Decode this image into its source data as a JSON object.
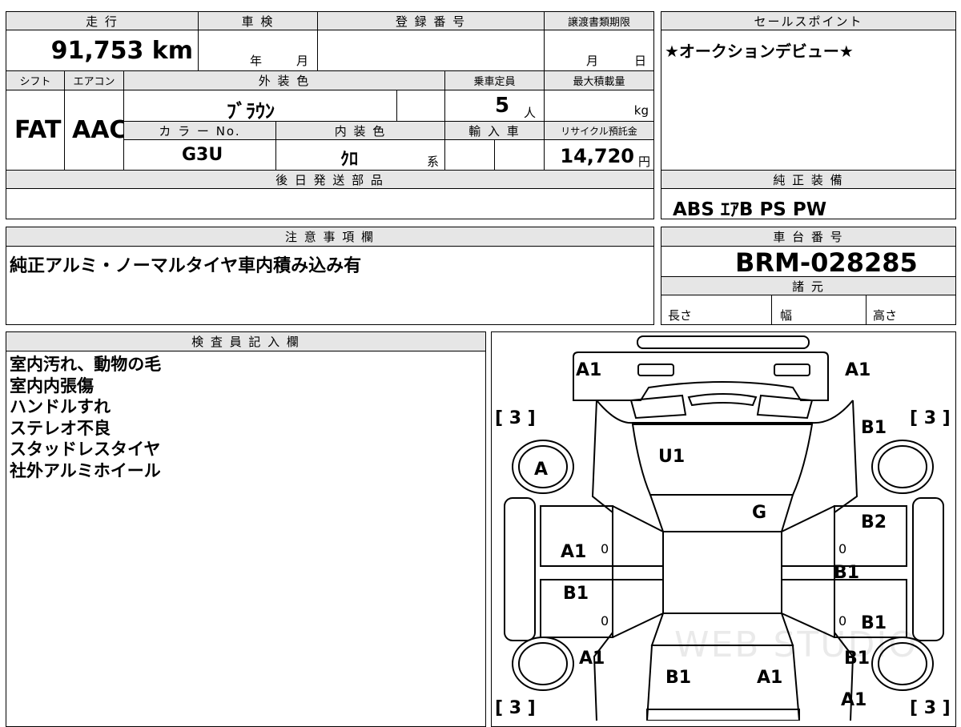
{
  "top_left": {
    "mileage_label": "走 行",
    "mileage_value": "91,753 km",
    "inspection_label": "車 検",
    "inspection_year_unit": "年",
    "inspection_month_unit": "月",
    "registration_label": "登 録 番 号",
    "transfer_label": "譲渡書類期限",
    "transfer_month_unit": "月",
    "transfer_day_unit": "日",
    "shift_label": "シフト",
    "shift_value": "FAT",
    "ac_label": "エアコン",
    "ac_value": "AAC",
    "exterior_color_label": "外 装 色",
    "exterior_color_value": "ﾌﾞﾗｳﾝ",
    "capacity_label": "乗車定員",
    "capacity_value": "5",
    "capacity_unit": "人",
    "max_load_label": "最大積載量",
    "max_load_unit": "kg",
    "color_no_label": "カ ラ ー No.",
    "color_no_value": "G3U",
    "interior_color_label": "内 装 色",
    "interior_color_value": "ｸﾛ",
    "interior_color_suffix": "系",
    "import_label": "輸 入 車",
    "recycle_label": "リサイクル預託金",
    "recycle_value": "14,720",
    "recycle_unit": "円",
    "later_parts_label": "後 日 発 送 部 品"
  },
  "selling_points": {
    "label": "セールスポイント",
    "text": "★オークションデビュー★"
  },
  "genuine_equipment": {
    "label": "純 正 装 備",
    "value": "ABS ｴｱB PS PW"
  },
  "notes": {
    "label": "注 意 事 項 欄",
    "text": "純正アルミ・ノーマルタイヤ車内積み込み有"
  },
  "chassis": {
    "label": "車 台 番 号",
    "value": "BRM-028285"
  },
  "specs": {
    "label": "諸 元",
    "length_label": "長さ",
    "width_label": "幅",
    "height_label": "高さ"
  },
  "inspector": {
    "label": "検 査 員 記 入 欄",
    "lines": [
      "室内汚れ、動物の毛",
      "室内内張傷",
      "ハンドルすれ",
      "ステレオ不良",
      "スタッドレスタイヤ",
      "社外アルミホイール"
    ]
  },
  "car_map": {
    "watermark": "WEB STUDIO",
    "marks": {
      "hood_left": "A1",
      "hood_right": "A1",
      "tire_fl": "[ 3 ]",
      "tire_fr": "[ 3 ]",
      "tire_rl": "[ 3 ]",
      "tire_rr": "[ 3 ]",
      "front_wheel_left": "A",
      "fender_right": "B1",
      "windshield": "U1",
      "roof": "G",
      "front_door_left": "A1",
      "front_door_left_zero": "0",
      "rear_door_left": "B1",
      "rear_door_left_zero": "0",
      "front_door_right": "B2",
      "front_door_right_zero": "0",
      "rocker_right": "B1",
      "rear_door_right": "B1",
      "rear_door_right_zero": "0",
      "rear_fender_left": "A1",
      "rear_fender_right": "B1",
      "rear_left": "B1",
      "rear_right": "A1",
      "rear_bumper_right": "A1"
    }
  }
}
